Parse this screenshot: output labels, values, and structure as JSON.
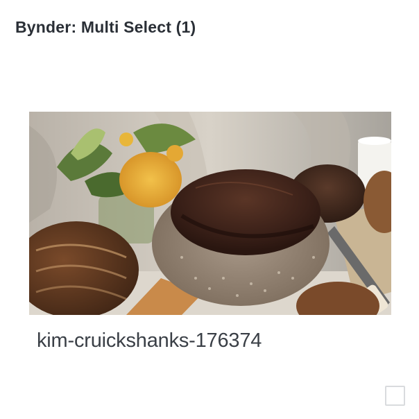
{
  "header": {
    "title": "Bynder: Multi Select (1)"
  },
  "asset": {
    "name": "kim-cruickshanks-176374",
    "thumbnail_subject": "sourdough-bread-photo",
    "selected": false
  },
  "colors": {
    "title_text": "#2a2f36",
    "asset_name_text": "#3a3f46",
    "checkbox_border": "#d9dbde",
    "background": "#ffffff"
  }
}
